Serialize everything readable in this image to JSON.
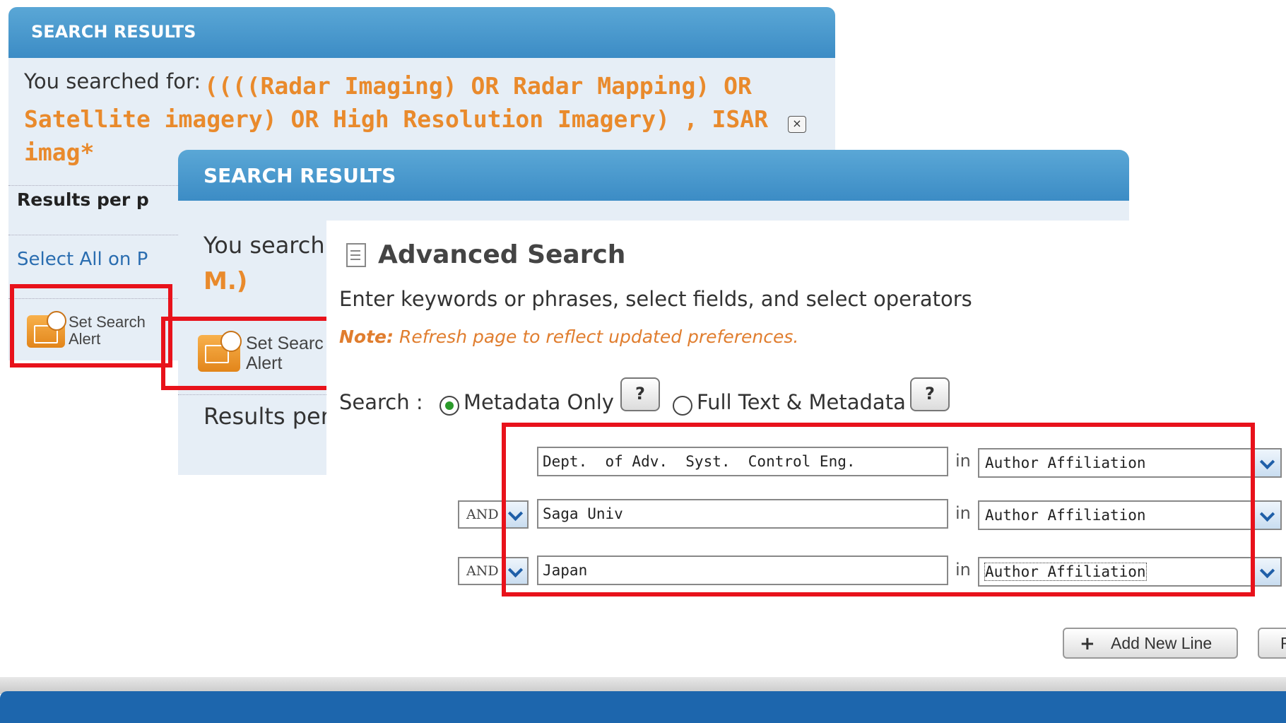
{
  "back_panel": {
    "header": "SEARCH RESULTS",
    "searched_label": "You searched for:",
    "query": "((((Radar Imaging) OR Radar Mapping) OR Satellite imagery) OR High Resolution Imagery) , ISAR imag*",
    "close_glyph": "×",
    "results_per_page": "Results per p",
    "select_all": "Select All on P",
    "alert_line1": "Set Search",
    "alert_line2": "Alert"
  },
  "middle_panel": {
    "header": "SEARCH RESULTS",
    "searched_label": "You search",
    "query_tail": "M.)",
    "alert_line1": "Set Searc",
    "alert_line2": "Alert",
    "results_per_page": "Results per"
  },
  "advanced": {
    "title": "Advanced Search",
    "instructions": "Enter keywords or phrases, select fields, and select operators",
    "note_label": "Note:",
    "note_text": "Refresh page to reflect updated preferences.",
    "search_label": "Search :",
    "options": [
      {
        "label": "Metadata Only",
        "selected": true
      },
      {
        "label": "Full Text & Metadata",
        "selected": false
      }
    ],
    "help_glyph": "?",
    "rows": [
      {
        "operator": "",
        "term": "Dept.  of Adv.  Syst.  Control Eng.",
        "in": "in",
        "field": "Author Affiliation"
      },
      {
        "operator": "AND",
        "term": "Saga Univ",
        "in": "in",
        "field": "Author Affiliation"
      },
      {
        "operator": "AND",
        "term": "Japan",
        "in": "in",
        "field": "Author Affiliation"
      }
    ],
    "add_line_label": "Add New Line",
    "next_button_partial": "F"
  },
  "colors": {
    "highlight_box": "#e8121b",
    "query_orange": "#e98a2c",
    "header_blue": "#3c8cc5",
    "footer_blue": "#1d66ad"
  }
}
